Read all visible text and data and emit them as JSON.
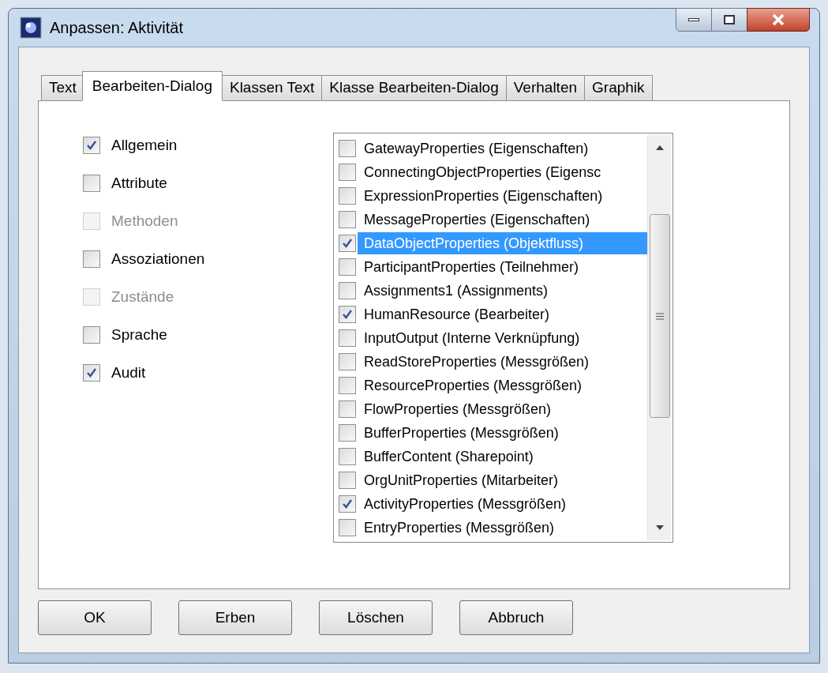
{
  "window": {
    "title": "Anpassen: Aktivität"
  },
  "tabs": [
    {
      "label": "Text",
      "selected": false
    },
    {
      "label": "Bearbeiten-Dialog",
      "selected": true
    },
    {
      "label": "Klassen Text",
      "selected": false
    },
    {
      "label": "Klasse Bearbeiten-Dialog",
      "selected": false
    },
    {
      "label": "Verhalten",
      "selected": false
    },
    {
      "label": "Graphik",
      "selected": false
    }
  ],
  "options": [
    {
      "label": "Allgemein",
      "checked": true,
      "disabled": false
    },
    {
      "label": "Attribute",
      "checked": false,
      "disabled": false
    },
    {
      "label": "Methoden",
      "checked": false,
      "disabled": true
    },
    {
      "label": "Assoziationen",
      "checked": false,
      "disabled": false
    },
    {
      "label": "Zustände",
      "checked": false,
      "disabled": true
    },
    {
      "label": "Sprache",
      "checked": false,
      "disabled": false
    },
    {
      "label": "Audit",
      "checked": true,
      "disabled": false
    }
  ],
  "properties": [
    {
      "label": "GatewayProperties (Eigenschaften)",
      "checked": false,
      "selected": false
    },
    {
      "label": "ConnectingObjectProperties (Eigensc",
      "checked": false,
      "selected": false
    },
    {
      "label": "ExpressionProperties (Eigenschaften)",
      "checked": false,
      "selected": false
    },
    {
      "label": "MessageProperties (Eigenschaften)",
      "checked": false,
      "selected": false
    },
    {
      "label": "DataObjectProperties (Objektfluss)",
      "checked": true,
      "selected": true
    },
    {
      "label": "ParticipantProperties (Teilnehmer)",
      "checked": false,
      "selected": false
    },
    {
      "label": "Assignments1 (Assignments)",
      "checked": false,
      "selected": false
    },
    {
      "label": "HumanResource (Bearbeiter)",
      "checked": true,
      "selected": false
    },
    {
      "label": "InputOutput (Interne Verknüpfung)",
      "checked": false,
      "selected": false
    },
    {
      "label": "ReadStoreProperties (Messgrößen)",
      "checked": false,
      "selected": false
    },
    {
      "label": "ResourceProperties (Messgrößen)",
      "checked": false,
      "selected": false
    },
    {
      "label": "FlowProperties (Messgrößen)",
      "checked": false,
      "selected": false
    },
    {
      "label": "BufferProperties (Messgrößen)",
      "checked": false,
      "selected": false
    },
    {
      "label": "BufferContent (Sharepoint)",
      "checked": false,
      "selected": false
    },
    {
      "label": "OrgUnitProperties (Mitarbeiter)",
      "checked": false,
      "selected": false
    },
    {
      "label": "ActivityProperties (Messgrößen)",
      "checked": true,
      "selected": false
    },
    {
      "label": "EntryProperties (Messgrößen)",
      "checked": false,
      "selected": false
    }
  ],
  "buttons": [
    "OK",
    "Erben",
    "Löschen",
    "Abbruch"
  ]
}
